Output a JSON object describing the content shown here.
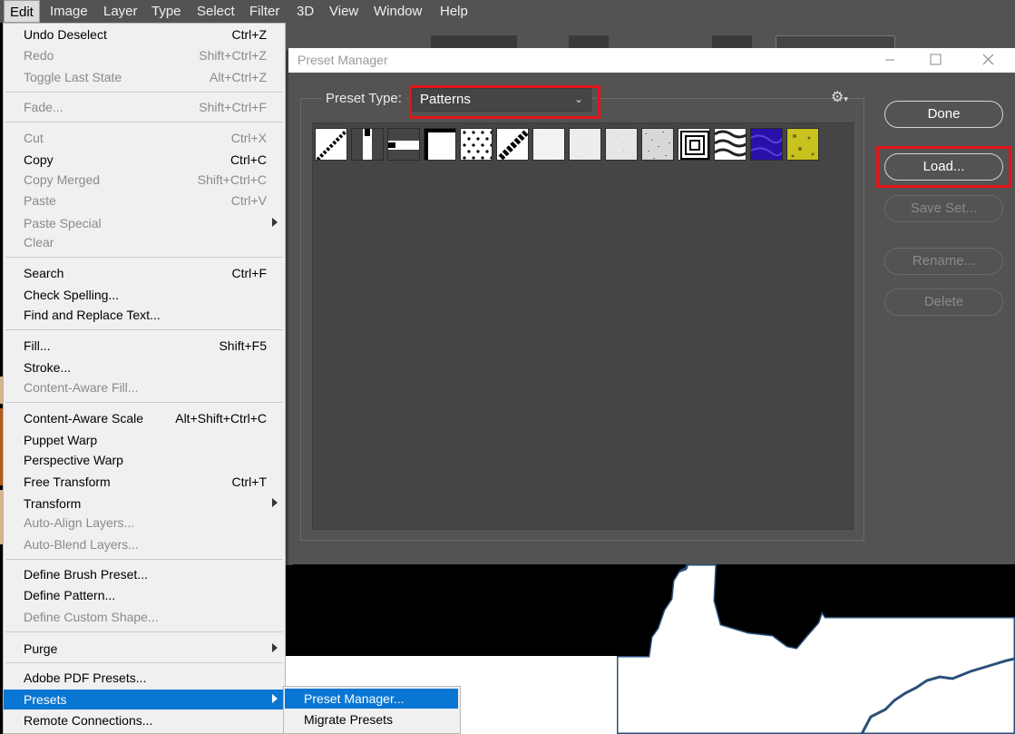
{
  "menubar": {
    "items": [
      "Edit",
      "Image",
      "Layer",
      "Type",
      "Select",
      "Filter",
      "3D",
      "View",
      "Window",
      "Help"
    ]
  },
  "edit_menu": {
    "items": [
      {
        "label": "Undo Deselect",
        "shortcut": "Ctrl+Z",
        "enabled": true
      },
      {
        "label": "Redo",
        "shortcut": "Shift+Ctrl+Z",
        "enabled": false
      },
      {
        "label": "Toggle Last State",
        "shortcut": "Alt+Ctrl+Z",
        "enabled": false
      },
      {
        "label": "Fade...",
        "shortcut": "Shift+Ctrl+F",
        "enabled": false
      },
      {
        "label": "Cut",
        "shortcut": "Ctrl+X",
        "enabled": false
      },
      {
        "label": "Copy",
        "shortcut": "Ctrl+C",
        "enabled": true
      },
      {
        "label": "Copy Merged",
        "shortcut": "Shift+Ctrl+C",
        "enabled": false
      },
      {
        "label": "Paste",
        "shortcut": "Ctrl+V",
        "enabled": false
      },
      {
        "label": "Paste Special",
        "shortcut": "",
        "enabled": false
      },
      {
        "label": "Clear",
        "shortcut": "",
        "enabled": false
      },
      {
        "label": "Search",
        "shortcut": "Ctrl+F",
        "enabled": true
      },
      {
        "label": "Check Spelling...",
        "shortcut": "",
        "enabled": true
      },
      {
        "label": "Find and Replace Text...",
        "shortcut": "",
        "enabled": true
      },
      {
        "label": "Fill...",
        "shortcut": "Shift+F5",
        "enabled": true
      },
      {
        "label": "Stroke...",
        "shortcut": "",
        "enabled": true
      },
      {
        "label": "Content-Aware Fill...",
        "shortcut": "",
        "enabled": false
      },
      {
        "label": "Content-Aware Scale",
        "shortcut": "Alt+Shift+Ctrl+C",
        "enabled": true
      },
      {
        "label": "Puppet Warp",
        "shortcut": "",
        "enabled": true
      },
      {
        "label": "Perspective Warp",
        "shortcut": "",
        "enabled": true
      },
      {
        "label": "Free Transform",
        "shortcut": "Ctrl+T",
        "enabled": true
      },
      {
        "label": "Transform",
        "shortcut": "",
        "enabled": true
      },
      {
        "label": "Auto-Align Layers...",
        "shortcut": "",
        "enabled": false
      },
      {
        "label": "Auto-Blend Layers...",
        "shortcut": "",
        "enabled": false
      },
      {
        "label": "Define Brush Preset...",
        "shortcut": "",
        "enabled": true
      },
      {
        "label": "Define Pattern...",
        "shortcut": "",
        "enabled": true
      },
      {
        "label": "Define Custom Shape...",
        "shortcut": "",
        "enabled": false
      },
      {
        "label": "Purge",
        "shortcut": "",
        "enabled": true
      },
      {
        "label": "Adobe PDF Presets...",
        "shortcut": "",
        "enabled": true
      },
      {
        "label": "Presets",
        "shortcut": "",
        "enabled": true
      },
      {
        "label": "Remote Connections...",
        "shortcut": "",
        "enabled": true
      }
    ]
  },
  "presets_submenu": {
    "items": [
      "Preset Manager...",
      "Migrate Presets"
    ],
    "selected": "Preset Manager..."
  },
  "dialog": {
    "title": "Preset Manager",
    "preset_type_label": "Preset Type:",
    "preset_type_value": "Patterns",
    "buttons": {
      "done": "Done",
      "load": "Load...",
      "save_set": "Save Set...",
      "rename": "Rename...",
      "delete": "Delete"
    },
    "highlight_color": "#e3141a",
    "pattern_count": 14
  },
  "colors": {
    "menu_selection": "#0a76d3",
    "dialog_bg": "#535353",
    "pattern_area": "#454545"
  }
}
